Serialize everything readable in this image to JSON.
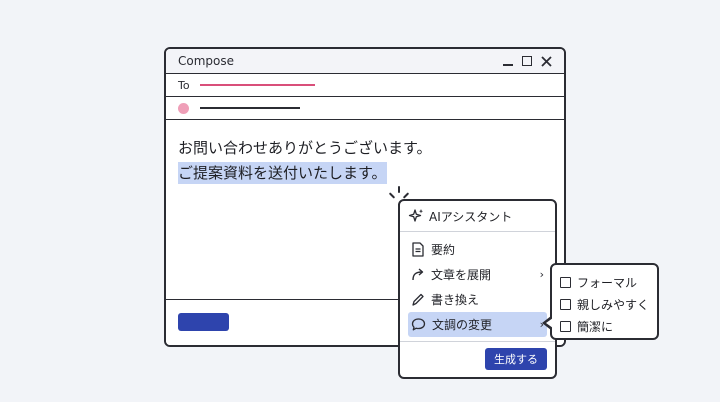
{
  "window": {
    "title": "Compose",
    "to_label": "To",
    "body_line1": "お問い合わせありがとうございます。",
    "body_line2": "ご提案資料を送付いたします。"
  },
  "ai_menu": {
    "title": "AIアシスタント",
    "items": [
      {
        "label": "要約",
        "icon": "document-icon",
        "submenu": false
      },
      {
        "label": "文章を展開",
        "icon": "forward-arrow-icon",
        "submenu": true
      },
      {
        "label": "書き換え",
        "icon": "pencil-icon",
        "submenu": false
      },
      {
        "label": "文調の変更",
        "icon": "speech-bubble-icon",
        "submenu": true,
        "active": true
      }
    ],
    "generate_label": "生成する"
  },
  "tone_submenu": {
    "items": [
      {
        "label": "フォーマル",
        "checked": false
      },
      {
        "label": "親しみやすく",
        "checked": false
      },
      {
        "label": "簡潔に",
        "checked": false
      }
    ]
  },
  "colors": {
    "accent": "#2e44ad",
    "highlight": "#c6d5f5",
    "to_underline": "#d94f7a",
    "avatar_dot": "#ef9fb8"
  }
}
